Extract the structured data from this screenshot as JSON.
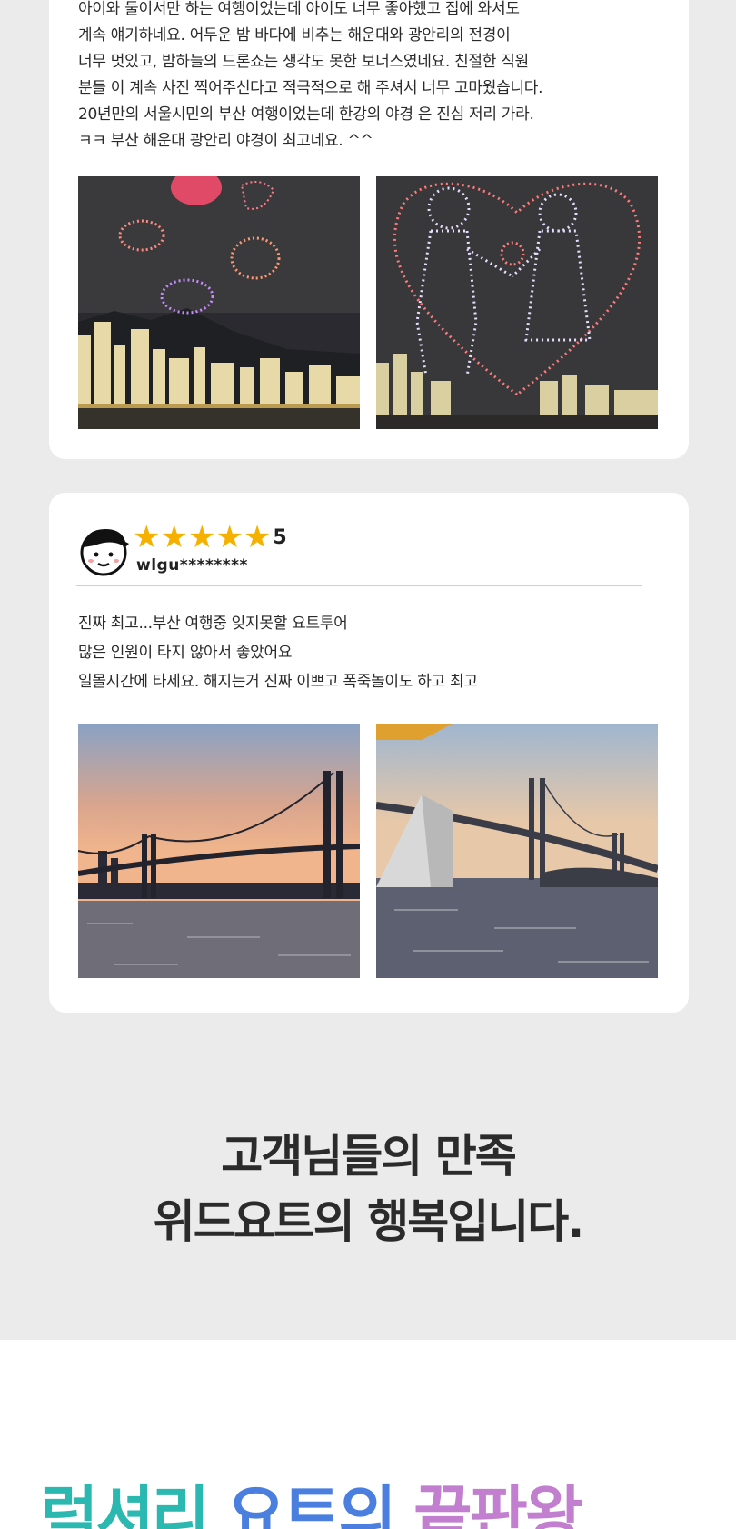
{
  "review1": {
    "lines": [
      "아이와 둘이서만 하는 여행이었는데 아이도 너무 좋아했고 집에 와서도",
      "계속 얘기하네요. 어두운 밤 바다에 비추는 해운대와 광안리의 전경이",
      "너무 멋있고, 밤하늘의 드론쇼는 생각도 못한 보너스였네요. 친절한 직원",
      "분들 이 계속 사진 찍어주신다고 적극적으로 해 주셔서 너무 고마웠습니다.",
      "20년만의 서울시민의 부산 여행이었는데 한강의 야경 은 진심 저리 가라.",
      "ㅋㅋ 부산 해운대 광안리 야경이 최고네요. ^^"
    ],
    "photos": [
      "drone-show-photo-city",
      "drone-show-photo-couple"
    ]
  },
  "review2": {
    "stars": "★★★★★",
    "rating": "5",
    "username": "wlgu********",
    "lines": [
      "진짜 최고...부산 여행중 잊지못할 요트투어",
      "많은 인원이 타지 않아서 좋았어요",
      "일몰시간에 타세요. 해지는거 진짜 이쁘고 폭죽놀이도 하고 최고"
    ],
    "photos": [
      "sunset-bridge-photo",
      "bridge-from-yacht-photo"
    ]
  },
  "headline": {
    "line1": "고객님들의 만족",
    "line2": "위드요트의 행복입니다."
  },
  "bottom_title": {
    "part1": "럭셔리 ",
    "part2": "요트의 ",
    "part3": "끝판왕"
  },
  "colors": {
    "background_gray": "#ebebeb",
    "star": "#f6b000",
    "title_teal": "#2bb8b0",
    "title_blue": "#4a7fe0",
    "title_purple": "#c27fd0"
  }
}
